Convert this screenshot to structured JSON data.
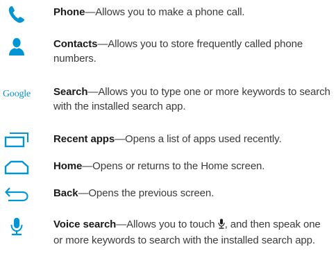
{
  "colors": {
    "icon": "#0096d6",
    "term": "#1a1a1a",
    "body": "#3a3a3a"
  },
  "items": [
    {
      "icon": "phone-icon",
      "term": "Phone",
      "desc": "—Allows you to make a phone call."
    },
    {
      "icon": "contacts-icon",
      "term": "Contacts",
      "desc": "—Allows you to store frequently called phone numbers."
    },
    {
      "icon": "google-logo",
      "icon_text": "Google",
      "term": "Search",
      "desc": "—Allows you to type one or more keywords to search with the installed search app."
    },
    {
      "icon": "recent-apps-icon",
      "term": "Recent apps",
      "desc": "—Opens a list of apps used recently."
    },
    {
      "icon": "home-icon",
      "term": "Home",
      "desc": "—Opens or returns to the Home screen."
    },
    {
      "icon": "back-icon",
      "term": "Back",
      "desc": "—Opens the previous screen."
    },
    {
      "icon": "microphone-icon",
      "term": "Voice search",
      "desc_before": "—Allows you to touch ",
      "desc_after": ", and then speak one or more keywords to search with the installed search app."
    }
  ]
}
